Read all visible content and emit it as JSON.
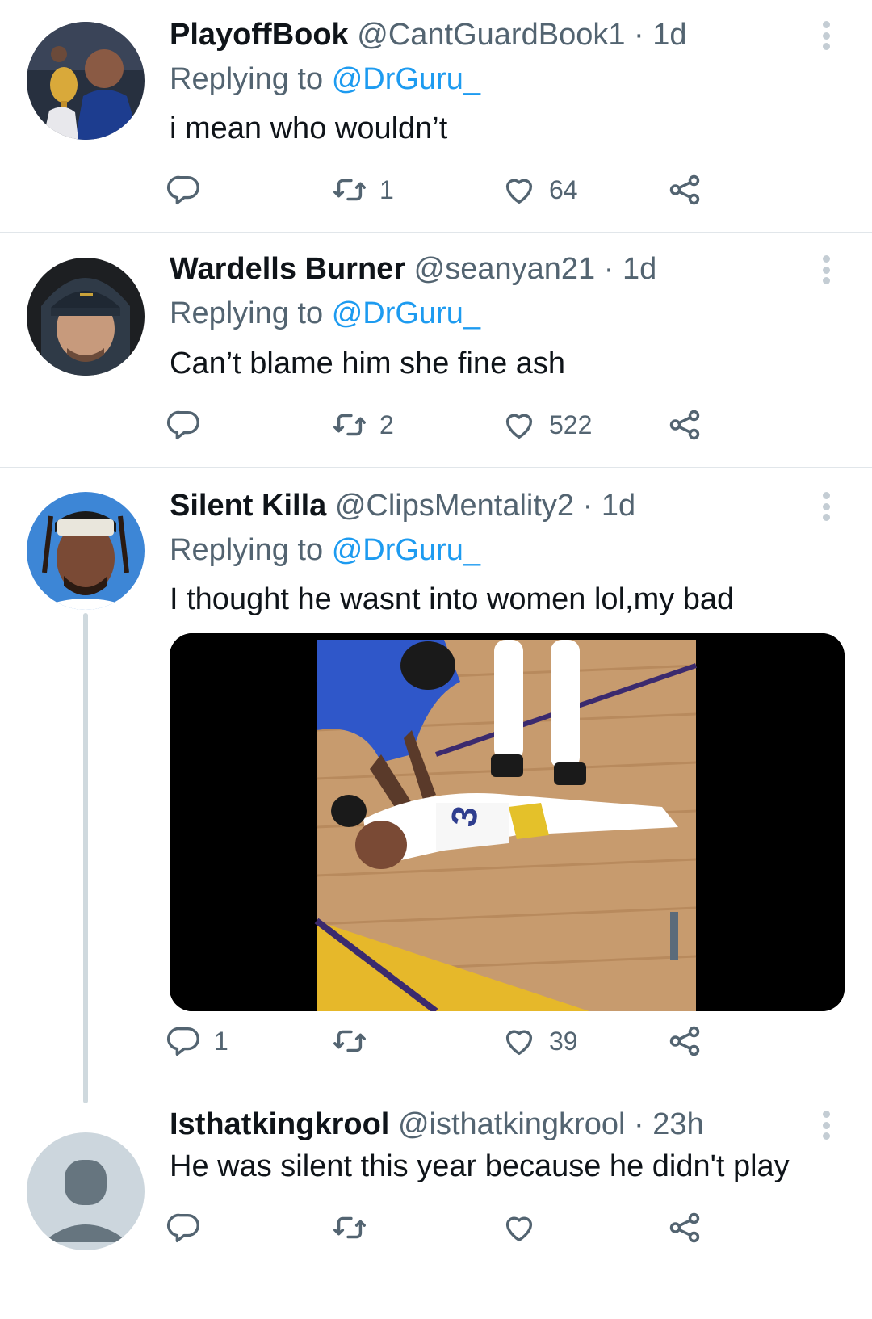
{
  "tweets": [
    {
      "name": "PlayoffBook",
      "handle": "@CantGuardBook1",
      "separator": "·",
      "time": "1d",
      "replying_prefix": "Replying to",
      "replying_to": "@DrGuru_",
      "text": "i mean who wouldn’t",
      "reply_count": "",
      "retweet_count": "1",
      "like_count": "64"
    },
    {
      "name": "Wardells Burner",
      "handle": "@seanyan21",
      "separator": "·",
      "time": "1d",
      "replying_prefix": "Replying to",
      "replying_to": "@DrGuru_",
      "text": "Can’t blame him she fine ash",
      "reply_count": "",
      "retweet_count": "2",
      "like_count": "522"
    },
    {
      "name": "Silent Killa",
      "handle": "@ClipsMentality2",
      "separator": "·",
      "time": "1d",
      "replying_prefix": "Replying to",
      "replying_to": "@DrGuru_",
      "text": "I thought he wasnt into women lol,my bad",
      "reply_count": "1",
      "retweet_count": "",
      "like_count": "39"
    },
    {
      "name": "Isthatkingkrool",
      "handle": "@isthatkingkrool",
      "separator": "·",
      "time": "23h",
      "text": "He was silent this year because he didn't play",
      "reply_count": "",
      "retweet_count": "",
      "like_count": ""
    }
  ],
  "icons": {
    "reply": "reply-icon",
    "retweet": "retweet-icon",
    "like": "heart-icon",
    "share": "share-icon",
    "more": "more-options-icon"
  },
  "colors": {
    "link": "#1d9bf0",
    "secondary_text": "#536471",
    "primary_text": "#0f1419",
    "divider": "#e1e6ea",
    "thread_line": "#cfd9de"
  }
}
